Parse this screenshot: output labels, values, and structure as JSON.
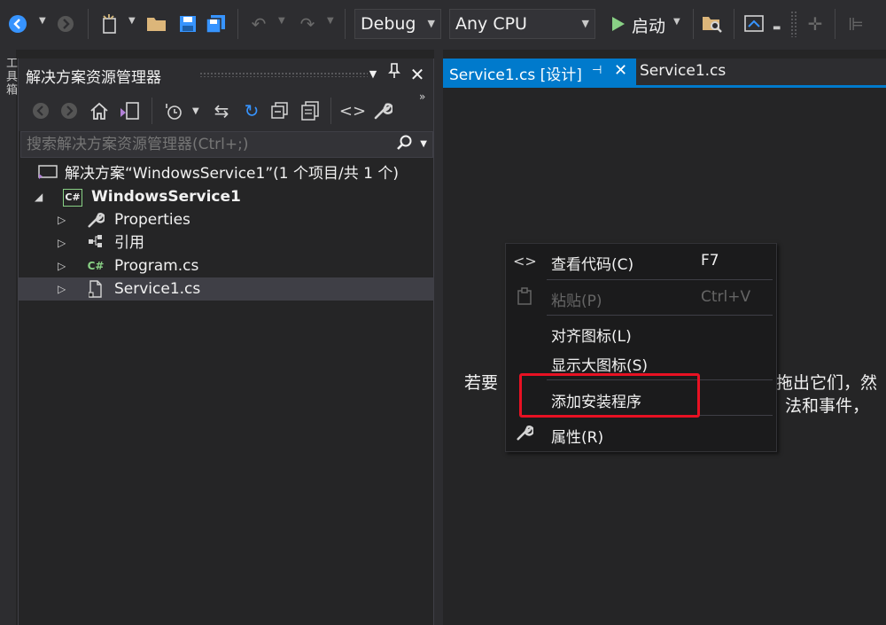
{
  "toolbar": {
    "config": "Debug",
    "platform": "Any CPU",
    "start_label": "启动"
  },
  "left_strip": {
    "label": "工具箱"
  },
  "solution_explorer": {
    "title": "解决方案资源管理器",
    "search_placeholder": "搜索解决方案资源管理器(Ctrl+;)",
    "tree": [
      {
        "label": "解决方案“WindowsService1”(1 个项目/共 1 个)",
        "icon": "solution-icon"
      },
      {
        "label": "WindowsService1",
        "icon": "csharp-project-icon"
      },
      {
        "label": "Properties",
        "icon": "wrench-icon"
      },
      {
        "label": "引用",
        "icon": "references-icon"
      },
      {
        "label": "Program.cs",
        "icon": "csharp-file-icon"
      },
      {
        "label": "Service1.cs",
        "icon": "component-file-icon"
      }
    ]
  },
  "editor": {
    "tabs": [
      {
        "label": "Service1.cs [设计]",
        "active": true
      },
      {
        "label": "Service1.cs",
        "active": false
      }
    ],
    "design_hint_left": "若要",
    "design_hint_right_1": "拖出它们，然",
    "design_hint_right_2": "法和事件，"
  },
  "context_menu": {
    "items": [
      {
        "label": "查看代码(C)",
        "shortcut": "F7",
        "icon": "code-icon",
        "enabled": true
      },
      {
        "label": "粘贴(P)",
        "shortcut": "Ctrl+V",
        "icon": "paste-icon",
        "enabled": false
      },
      {
        "label": "对齐图标(L)",
        "shortcut": "",
        "icon": "",
        "enabled": true
      },
      {
        "label": "显示大图标(S)",
        "shortcut": "",
        "icon": "",
        "enabled": true
      },
      {
        "label": "添加安装程序",
        "shortcut": "",
        "icon": "",
        "enabled": true
      },
      {
        "label": "属性(R)",
        "shortcut": "",
        "icon": "wrench-icon",
        "enabled": true
      }
    ]
  },
  "colors": {
    "accent": "#007acc",
    "highlight_box": "#e81123",
    "background": "#252526"
  }
}
